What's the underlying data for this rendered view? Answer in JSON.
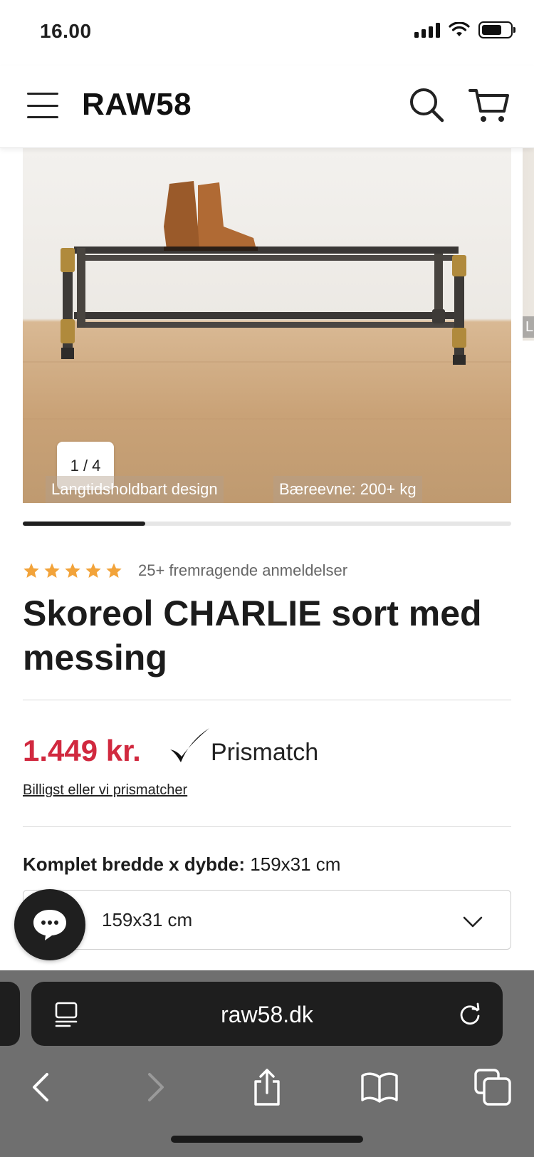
{
  "status": {
    "time": "16.00"
  },
  "header": {
    "logo": "RAW58"
  },
  "gallery": {
    "counter": "1 / 4",
    "badges": [
      "Langtidsholdbart design",
      "Bæreevne: 200+ kg"
    ],
    "next_peek_label": "L",
    "progress_fraction": 0.25
  },
  "product": {
    "rating_stars": 5,
    "star_color": "#f2a33a",
    "rating_text": "25+ fremragende anmeldelser",
    "title": "Skoreol CHARLIE sort med messing",
    "price": "1.449 kr.",
    "price_color": "#d1293f",
    "prismatch_label": "Prismatch",
    "price_link": "Billigst eller vi prismatcher",
    "option_label": "Komplet bredde x dybde:",
    "option_value": "159x31 cm",
    "select_value": "159x31 cm"
  },
  "browser": {
    "url": "raw58.dk"
  },
  "icons": [
    "menu-icon",
    "search-icon",
    "cart-icon",
    "chat-icon",
    "chevron-down-icon",
    "reader-icon",
    "reload-icon",
    "back-icon",
    "forward-icon",
    "share-icon",
    "bookmarks-icon",
    "tabs-icon"
  ]
}
